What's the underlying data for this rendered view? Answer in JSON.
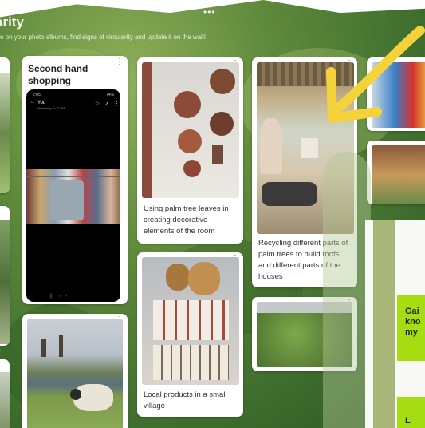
{
  "board": {
    "title": "arity",
    "subtitle": "o on your photo albums, find signs of circularity and update it on the wall!"
  },
  "cards": {
    "second_hand": {
      "heading": "Second hand shopping"
    },
    "phone": {
      "status_time": "2:05",
      "status_right": "74%",
      "name": "You",
      "date": "Yesterday, 4:37 PM"
    },
    "palm_leaves": {
      "caption": "Using palm tree leaves in creating decorative elements of the room"
    },
    "palm_trees": {
      "caption": "Recycling different parts of palm trees to build roofs, and different parts of the houses"
    },
    "local_products": {
      "caption": "Local products in a small village"
    }
  },
  "panel": {
    "lime1": [
      "Gai",
      "kno",
      "my"
    ],
    "lime2": "L"
  },
  "colors": {
    "board_green": "#5f8a3c",
    "arrow_yellow": "#f6d23a",
    "lime": "#a6dd12"
  },
  "icons": [
    "more-vertical-icon",
    "share-icon",
    "star-icon",
    "arrow-annotation-icon"
  ]
}
